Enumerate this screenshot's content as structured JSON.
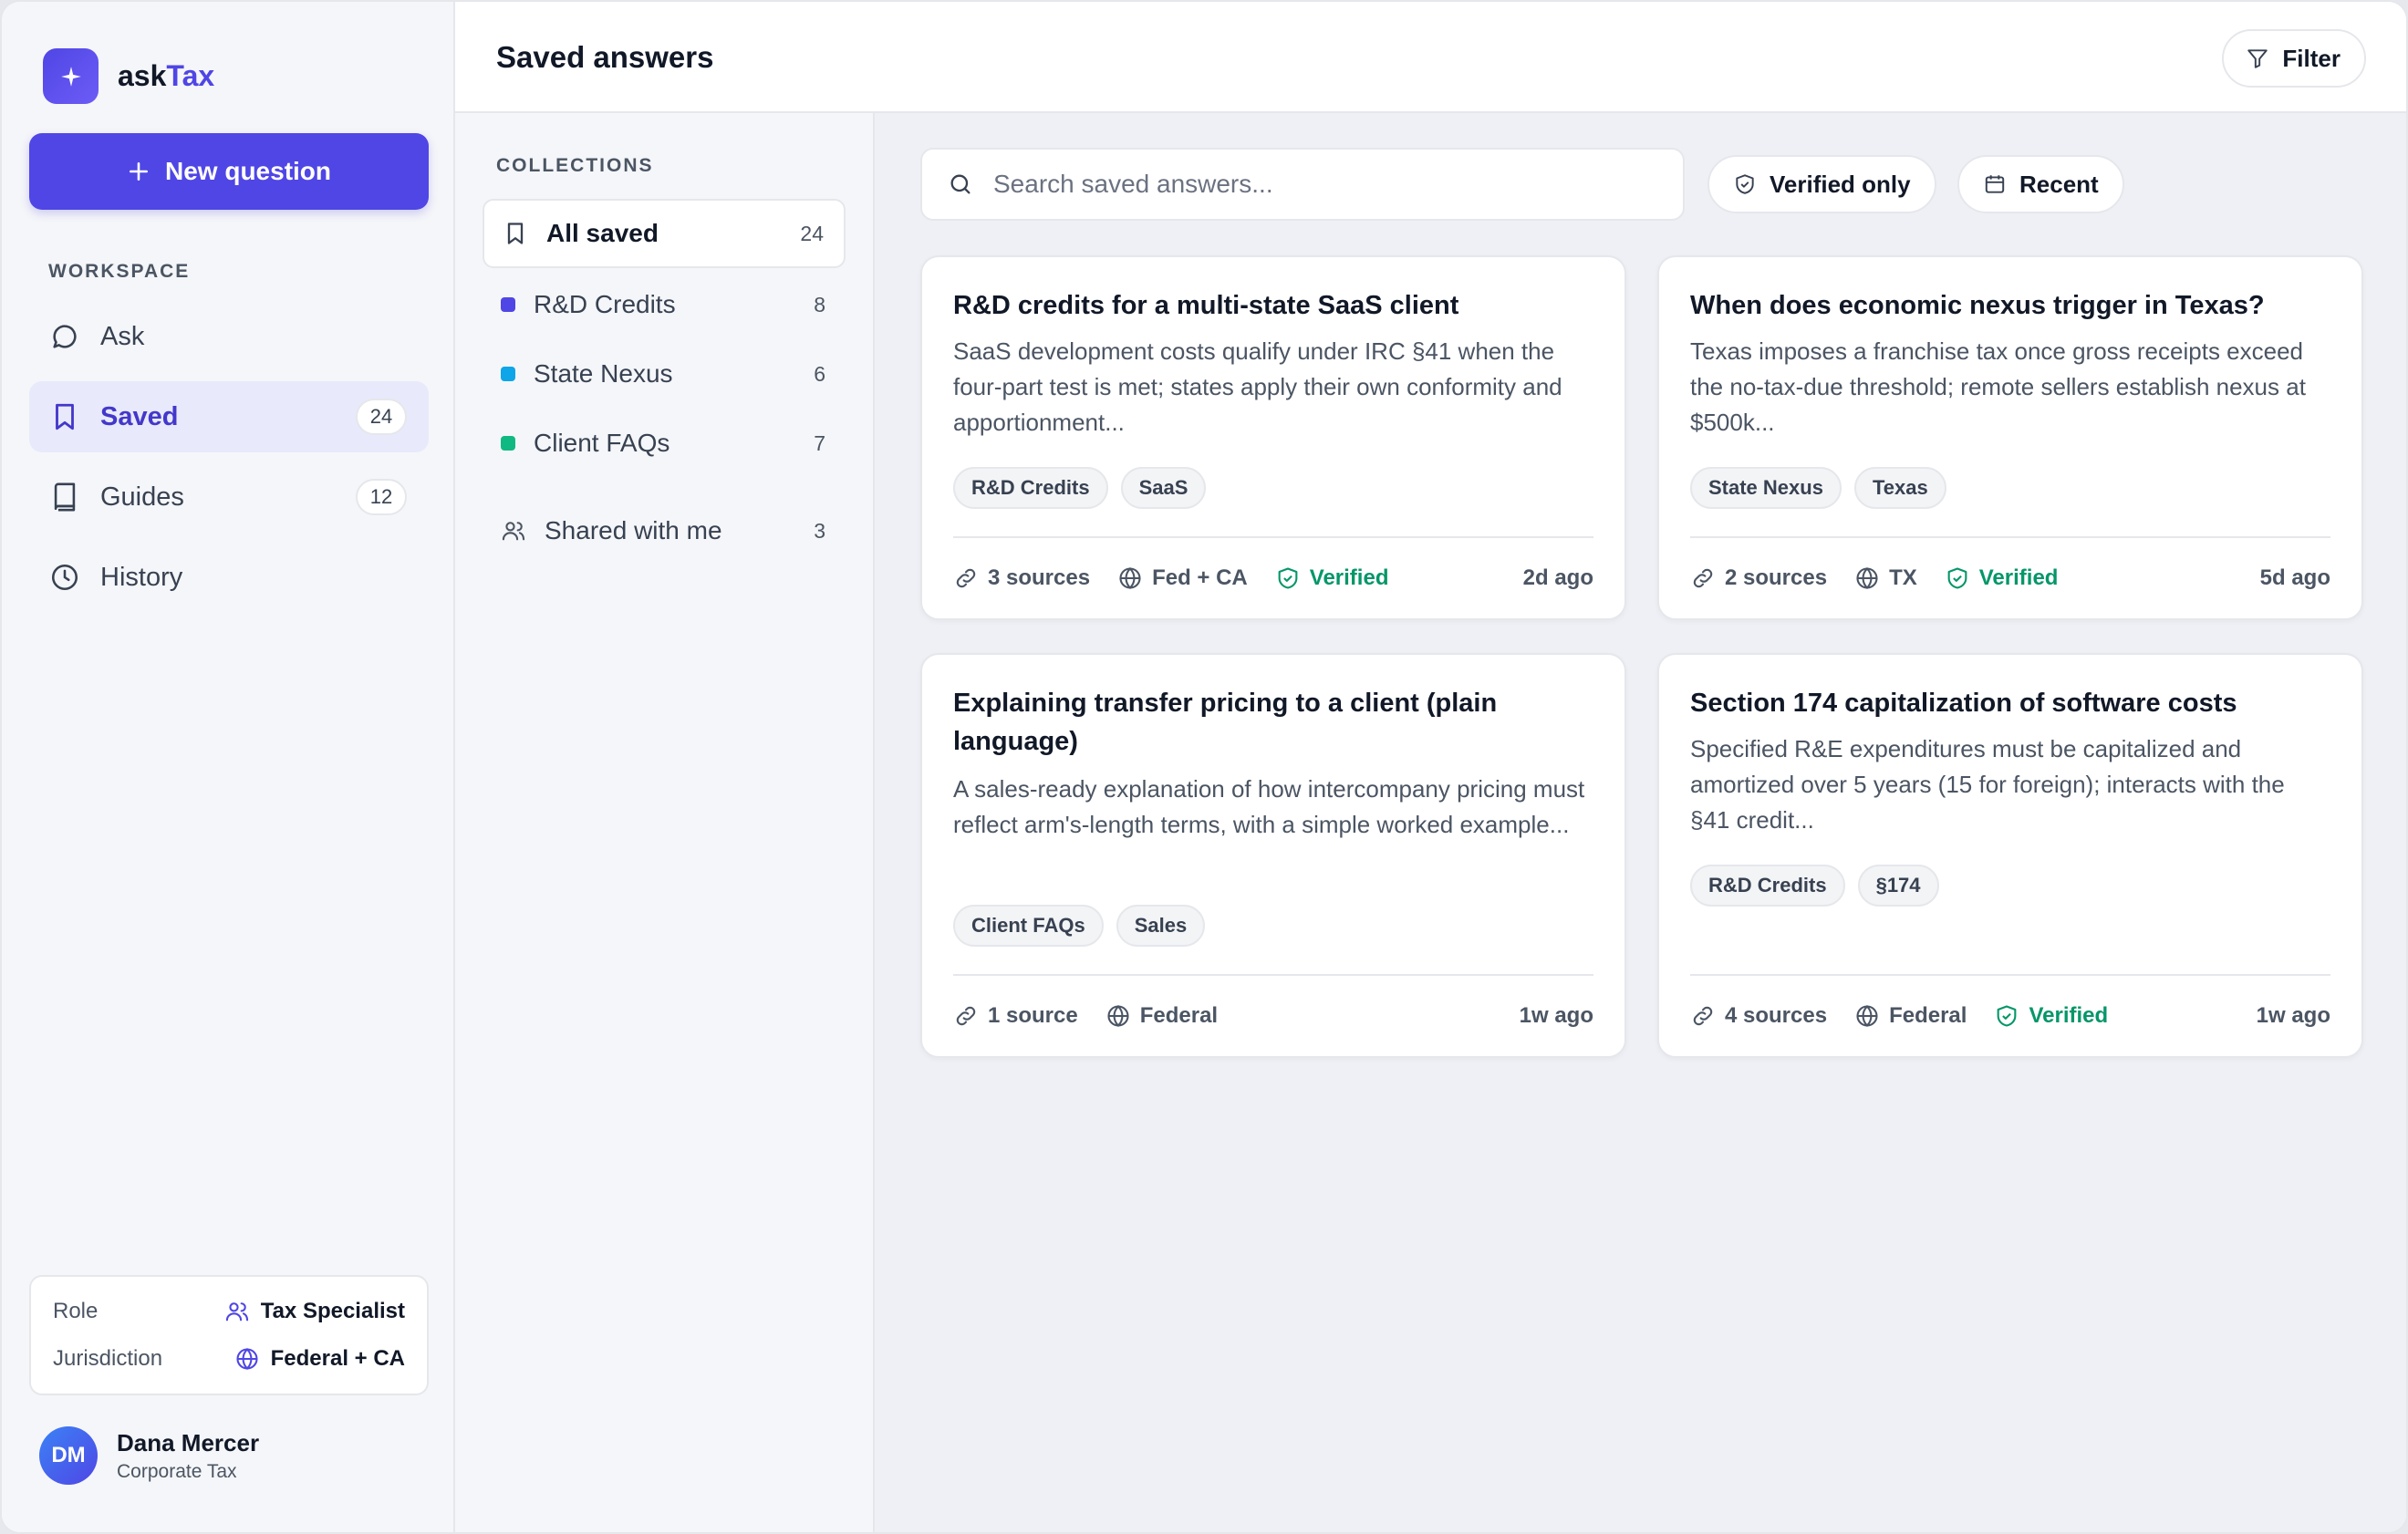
{
  "brand": {
    "prefix": "ask",
    "accent": "Tax"
  },
  "new_question_label": "New question",
  "sidebar": {
    "section_label": "WORKSPACE",
    "items": [
      {
        "label": "Ask",
        "icon": "chat-bubble-icon"
      },
      {
        "label": "Saved",
        "icon": "bookmark-icon",
        "badge": "24",
        "active": true
      },
      {
        "label": "Guides",
        "icon": "book-icon",
        "badge": "12"
      },
      {
        "label": "History",
        "icon": "clock-icon"
      }
    ],
    "profile": {
      "role_label": "Role",
      "role_value": "Tax Specialist",
      "jurisdiction_label": "Jurisdiction",
      "jurisdiction_value": "Federal + CA"
    },
    "user": {
      "initials": "DM",
      "name": "Dana Mercer",
      "subtitle": "Corporate Tax"
    }
  },
  "header": {
    "title": "Saved answers",
    "filter_label": "Filter"
  },
  "collections": {
    "section_label": "COLLECTIONS",
    "items": [
      {
        "label": "All saved",
        "count": "24",
        "icon": "bookmark-icon",
        "active": true
      },
      {
        "label": "R&D Credits",
        "count": "8",
        "color": "#4f46e5"
      },
      {
        "label": "State Nexus",
        "count": "6",
        "color": "#0ea5e9"
      },
      {
        "label": "Client FAQs",
        "count": "7",
        "color": "#10b981"
      },
      {
        "label": "Shared with me",
        "count": "3",
        "icon": "users-icon"
      }
    ]
  },
  "toolbar": {
    "search_placeholder": "Search saved answers...",
    "verified_label": "Verified only",
    "recent_label": "Recent"
  },
  "cards": [
    {
      "title": "R&D credits for a multi-state SaaS client",
      "description": "SaaS development costs qualify under IRC §41 when the four-part test is met; states apply their own conformity and apportionment...",
      "tags": [
        "R&D Credits",
        "SaaS"
      ],
      "sources": "3 sources",
      "jurisdiction": "Fed + CA",
      "verified": "Verified",
      "time": "2d ago"
    },
    {
      "title": "When does economic nexus trigger in Texas?",
      "description": "Texas imposes a franchise tax once gross receipts exceed the no-tax-due threshold; remote sellers establish nexus at $500k...",
      "tags": [
        "State Nexus",
        "Texas"
      ],
      "sources": "2 sources",
      "jurisdiction": "TX",
      "verified": "Verified",
      "time": "5d ago"
    },
    {
      "title": "Explaining transfer pricing to a client (plain language)",
      "description": "A sales-ready explanation of how intercompany pricing must reflect arm's-length terms, with a simple worked example...",
      "tags": [
        "Client FAQs",
        "Sales"
      ],
      "sources": "1 source",
      "jurisdiction": "Federal",
      "verified": "",
      "time": "1w ago"
    },
    {
      "title": "Section 174 capitalization of software costs",
      "description": "Specified R&E expenditures must be capitalized and amortized over 5 years (15 for foreign); interacts with the §41 credit...",
      "tags": [
        "R&D Credits",
        "§174"
      ],
      "sources": "4 sources",
      "jurisdiction": "Federal",
      "verified": "Verified",
      "time": "1w ago"
    }
  ],
  "colors": {
    "accent": "#4f46e5",
    "verified": "#059669",
    "background": "#eef0f5"
  }
}
